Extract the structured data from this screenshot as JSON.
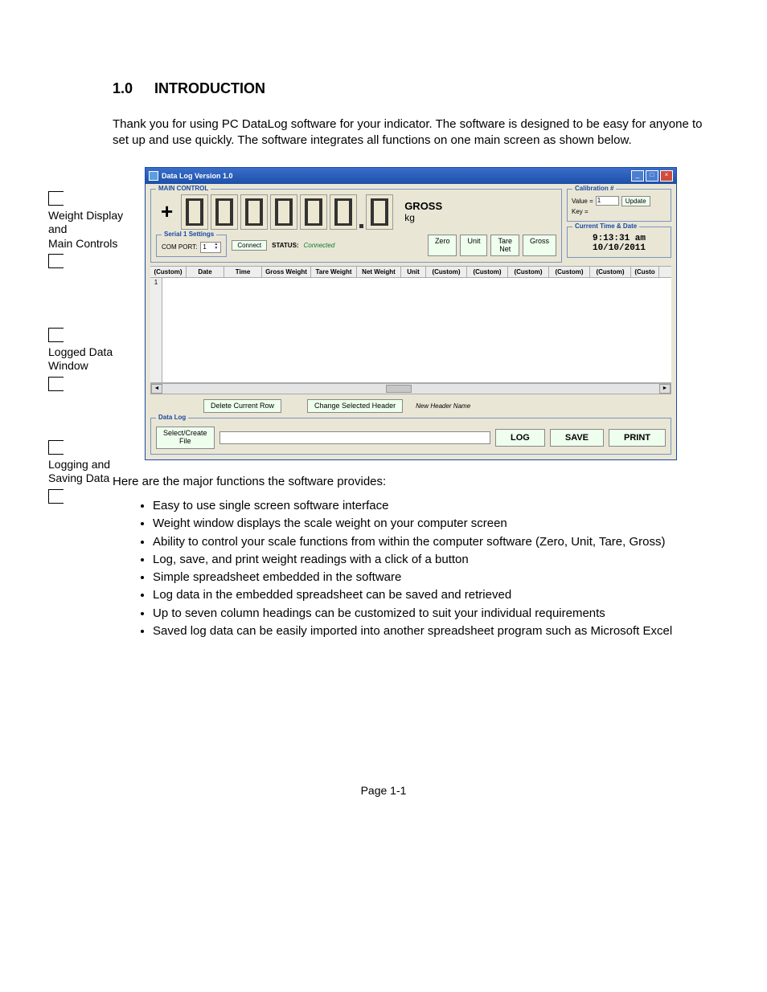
{
  "doc": {
    "section_number": "1.0",
    "section_title": "INTRODUCTION",
    "intro_paragraph": "Thank you for using PC DataLog software for your indicator. The software is designed to be easy for anyone to set up and use quickly. The software integrates all functions on one main screen as shown below.",
    "callouts": {
      "c1": "Weight Display and\nMain Controls",
      "c2": "Logged Data Window",
      "c3": "Logging and Saving Data"
    },
    "after_text": "Here are the major functions the software provides:",
    "features": [
      "Easy to use single screen software interface",
      "Weight window displays the scale weight on your computer screen",
      "Ability to control your scale functions from within the computer software (Zero, Unit, Tare, Gross)",
      "Log, save, and print weight readings with a click of a button",
      "Simple spreadsheet embedded in the software",
      "Log data in the embedded spreadsheet can be saved and retrieved",
      "Up to seven column headings can be customized to suit your individual requirements",
      "Saved log data can be easily imported into another spreadsheet program such as Microsoft Excel"
    ],
    "page_footer": "Page 1-1"
  },
  "app": {
    "window_title": "Data Log Version 1.0",
    "main_control_label": "MAIN CONTROL",
    "sign": "+",
    "gross_label": "GROSS",
    "unit_label": "kg",
    "serial_group_label": "Serial 1 Settings",
    "com_port_label": "COM PORT:",
    "com_port_value": "1",
    "connect_btn": "Connect",
    "status_label": "STATUS:",
    "status_value": "Connected",
    "btn_zero": "Zero",
    "btn_unit": "Unit",
    "btn_tare": "Tare\nNet",
    "btn_gross": "Gross",
    "calibration": {
      "group_label": "Calibration #",
      "value_label": "Value =",
      "value": "1",
      "key_label": "Key =",
      "update_btn": "Update"
    },
    "timedate": {
      "group_label": "Current Time & Date",
      "time": "9:13:31 am",
      "date": "10/10/2011"
    },
    "grid_headers": [
      "(Custom)",
      "Date",
      "Time",
      "Gross Weight",
      "Tare Weight",
      "Net Weight",
      "Unit",
      "(Custom)",
      "(Custom)",
      "(Custom)",
      "(Custom)",
      "(Custom)",
      "(Custo"
    ],
    "row_number": "1",
    "delete_row_btn": "Delete Current Row",
    "change_header_btn": "Change Selected Header",
    "new_header_label": "New Header Name",
    "datalog_label": "Data Log",
    "select_file_btn": "Select/Create\nFile",
    "log_btn": "LOG",
    "save_btn": "SAVE",
    "print_btn": "PRINT"
  }
}
